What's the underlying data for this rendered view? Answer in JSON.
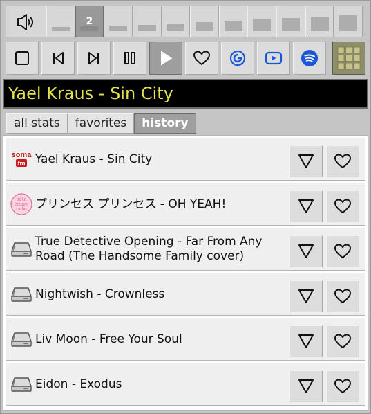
{
  "volume": {
    "speaker_icon": "speaker-icon",
    "selected_level": 2,
    "selected_label": "2",
    "levels": [
      1,
      2,
      3,
      4,
      5,
      6,
      7,
      8,
      9,
      10,
      11
    ]
  },
  "controls": [
    {
      "name": "stop-button",
      "icon": "stop-icon"
    },
    {
      "name": "previous-button",
      "icon": "skip-previous-icon"
    },
    {
      "name": "next-button",
      "icon": "skip-next-icon"
    },
    {
      "name": "pause-button",
      "icon": "pause-icon"
    },
    {
      "name": "play-button",
      "icon": "play-icon",
      "pressed": true
    },
    {
      "name": "favorite-button",
      "icon": "heart-icon"
    },
    {
      "name": "google-search-button",
      "icon": "google-icon"
    },
    {
      "name": "youtube-button",
      "icon": "youtube-icon"
    },
    {
      "name": "spotify-button",
      "icon": "spotify-icon"
    },
    {
      "name": "grid-menu-button",
      "icon": "grid-icon"
    }
  ],
  "now_playing": {
    "text": "Yael Kraus - Sin City"
  },
  "tabs": [
    {
      "label": "all stats",
      "active": false
    },
    {
      "label": "favorites",
      "active": false
    },
    {
      "label": "history",
      "active": true
    }
  ],
  "history": [
    {
      "source_icon": "soma-fm-logo",
      "logo_text": [
        "soma",
        "fm"
      ],
      "title": "Yael Kraus - Sin City"
    },
    {
      "source_icon": "bella-dream-radio-logo",
      "logo_text": [
        "bella",
        "dream",
        "radio"
      ],
      "title": "プリンセス プリンセス - OH YEAH!"
    },
    {
      "source_icon": "hard-drive-icon",
      "title": "True Detective Opening - Far From Any Road (The Handsome Family cover)"
    },
    {
      "source_icon": "hard-drive-icon",
      "title": "Nightwish - Crownless"
    },
    {
      "source_icon": "hard-drive-icon",
      "title": "Liv Moon - Free Your Soul"
    },
    {
      "source_icon": "hard-drive-icon",
      "title": "Eidon - Exodus"
    }
  ],
  "colors": {
    "panel_bg": "#c5c5c5",
    "now_playing_bg": "#000000",
    "now_playing_text": "#e2e24a",
    "google_blue": "#1a57d6",
    "youtube_blue": "#1a57d6",
    "spotify_blue": "#1a57d6",
    "grid_bg": "#8e8e6c",
    "grid_cell": "#c5c28a",
    "soma_red": "#cc1a1a",
    "bella_pink": "#e56b9a"
  }
}
